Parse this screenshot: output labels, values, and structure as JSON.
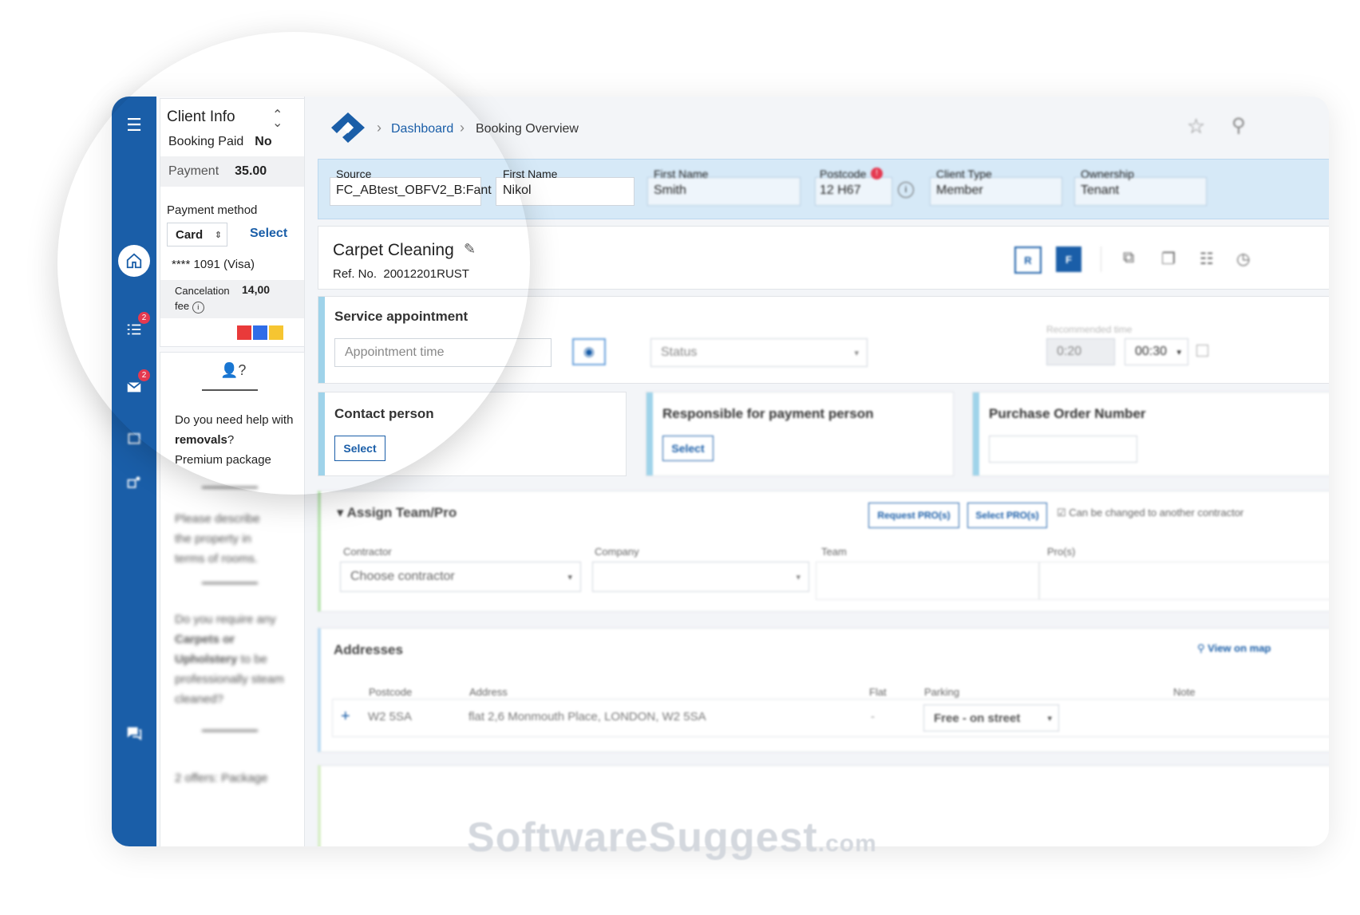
{
  "app": {
    "breadcrumb": [
      "Dashboard",
      "Booking Overview"
    ]
  },
  "rail": {
    "tasks_badge": "2",
    "mail_badge": "2"
  },
  "client_info": {
    "title": "Client Info",
    "booking_paid_label": "Booking Paid",
    "booking_paid_value": "No",
    "payment_label": "Payment",
    "payment_value": "35.00",
    "payment_method_label": "Payment method",
    "payment_method_value": "Card",
    "select_label": "Select",
    "card_number": "**** 1091 (Visa)",
    "cancelation_label": "Cancelation fee",
    "cancelation_value": "14,00",
    "color_tags": [
      "#e93a3a",
      "#2f6de8",
      "#f6c531"
    ]
  },
  "help_panel": {
    "q1_pre": "Do you need help with ",
    "q1_bold": "removals",
    "q1_post": "?",
    "q1_line2": "Premium package",
    "q2": "Please describe the property in terms of rooms.",
    "q3_pre": "Do you require any ",
    "q3_bold": "Carpets or Upholstery",
    "q3_post": " to be professionally steam cleaned?",
    "q4": "2 offers: Package"
  },
  "filters": {
    "source_label": "Source",
    "source_value": "FC_ABtest_OBFV2_B:Fant",
    "first_name_label": "First Name",
    "first_name_value": "Nikol",
    "last_name_label": "First Name",
    "last_name_value": "Smith",
    "postcode_label": "Postcode",
    "postcode_value": "12 H67",
    "postcode_badge": "!",
    "client_type_label": "Client Type",
    "client_type_value": "Member",
    "ownership_label": "Ownership",
    "ownership_value": "Tenant"
  },
  "booking": {
    "title": "Carpet Cleaning",
    "ref_label": "Ref. No.",
    "ref_value": "20012201RUST",
    "btn_r": "R",
    "btn_f": "F"
  },
  "service": {
    "title": "Service appointment",
    "appointment_placeholder": "Appointment time",
    "status_placeholder": "Status",
    "recommended_label": "Recommended time",
    "recommended_value": "0:20",
    "duration_value": "00:30"
  },
  "contact": {
    "title": "Contact person",
    "select_label": "Select"
  },
  "payment_person": {
    "title": "Responsible for payment person",
    "select_label": "Select"
  },
  "po": {
    "title": "Purchase Order Number"
  },
  "team": {
    "title": "Assign Team/Pro",
    "request_btn": "Request PRO(s)",
    "select_btn": "Select PRO(s)",
    "checkbox_label": "Can be changed to another contractor",
    "contractor_label": "Contractor",
    "contractor_placeholder": "Choose contractor",
    "company_label": "Company",
    "team_label": "Team",
    "pros_label": "Pro(s)"
  },
  "addresses": {
    "title": "Addresses",
    "view_link": "View on map",
    "columns": [
      "Postcode",
      "Address",
      "Flat",
      "Parking",
      "Note"
    ],
    "row": {
      "postcode": "W2 5SA",
      "address": "flat 2,6 Monmouth Place, LONDON, W2 5SA",
      "flat": "-",
      "parking": "Free - on street"
    }
  },
  "watermark": {
    "main": "SoftwareSuggest",
    "suffix": ".com"
  }
}
